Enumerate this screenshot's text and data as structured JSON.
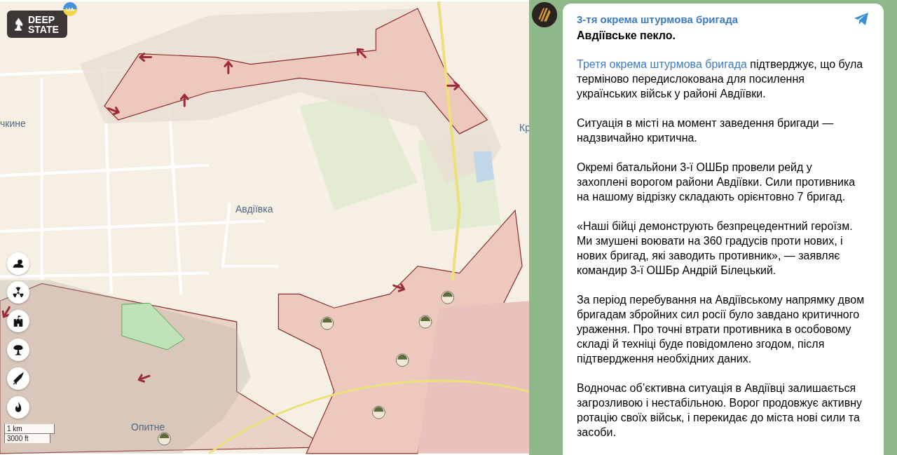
{
  "map": {
    "logo": {
      "text": "DEEP STATE",
      "badge": "UA"
    },
    "labels": [
      {
        "text": "чкине"
      },
      {
        "text": "Авдіївка"
      },
      {
        "text": "Кр"
      },
      {
        "text": "Опитне"
      }
    ],
    "tools": [
      {
        "kind": "weather"
      },
      {
        "kind": "radiation"
      },
      {
        "kind": "fortress"
      },
      {
        "kind": "explosion"
      },
      {
        "kind": "missile"
      },
      {
        "kind": "fire"
      }
    ],
    "scale": [
      "1 km",
      "3000 ft"
    ]
  },
  "post": {
    "channel": "3-тя окрема штурмова бригада",
    "title": "Авдіївське пекло.",
    "paragraphs": [
      {
        "link": "Третя окрема штурмова бригада",
        "text": " підтверджує, що була терміново передислокована для посилення українських військ у районі Авдіївки."
      },
      {
        "text": "Ситуація в місті на момент заведення бригади — надзвичайно критична."
      },
      {
        "text": "Окремі батальйони 3-ї ОШБр провели рейд у захоплені ворогом райони Авдіївки. Сили противника на нашому відрізку складають орієнтовно 7 бригад."
      },
      {
        "text": "«Наші бійці демонструють безпрецедентний героїзм. Ми змушені воювати на 360 градусів проти нових, і нових бригад, які заводить противник», — заявляє командир 3-ї ОШБр Андрій Білецький."
      },
      {
        "text": "За період перебування на Авдіївському напрямку двом бригадам збройних сил росії було завдано критичного ураження. Про точні втрати противника в особовому складі й техніці буде повідомлено згодом, після підтвердження необхідних даних."
      },
      {
        "text": "Водночас об’єктивна ситуація в Авдіївці залишається загрозливою і нестабільною. Ворог продовжує активну ротацію своїх військ, і перекидає до міста нові сили та засоби."
      }
    ]
  }
}
